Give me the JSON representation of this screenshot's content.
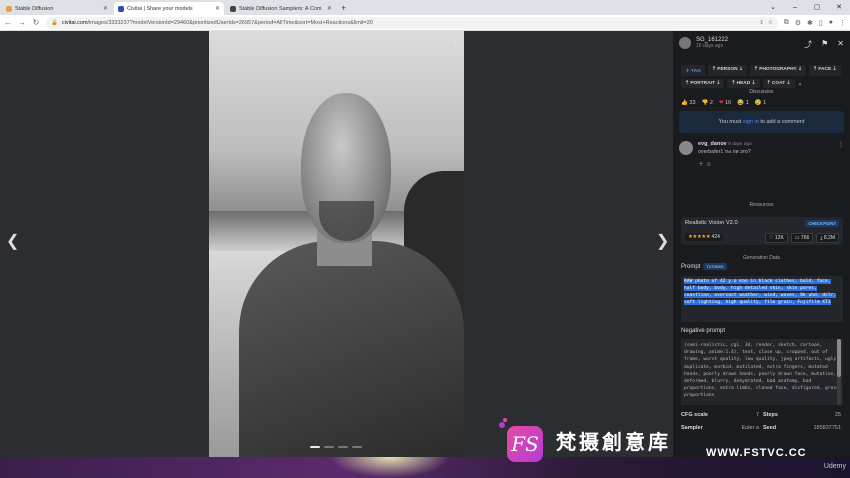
{
  "browser": {
    "tabs": [
      {
        "title": "Stable Diffusion",
        "color": "#e8a23a"
      },
      {
        "title": "Civitai | Share your models",
        "color": "#2d4fb5"
      },
      {
        "title": "Stable Diffusion Samplers: A Com",
        "color": "#444444"
      }
    ],
    "new_tab": "+",
    "url_host": "civitai.com",
    "url_path": "/images/3333237?modelVersionId=29460&prioritizedUserIds=26957&period=AllTime&sort=Most+Reactions&limit=20"
  },
  "panel": {
    "username": "SG_161222",
    "user_time": "16 days ago",
    "tags": [
      "TAG",
      "PERSON",
      "PHOTOGRAPHY",
      "FACE",
      "PORTRAIT",
      "HEAD",
      "COAT"
    ],
    "discussion_heading": "Discussion",
    "reactions": [
      {
        "icon": "👍",
        "count": "33"
      },
      {
        "icon": "👎",
        "count": "2"
      },
      {
        "icon": "❤",
        "count": "16"
      },
      {
        "icon": "😂",
        "count": "1"
      },
      {
        "icon": "😢",
        "count": "1"
      }
    ],
    "signin_prefix": "You must",
    "signin_link": "sign in",
    "signin_suffix": "to add a comment",
    "comment": {
      "author": "evg_danov",
      "time": "9 days ago",
      "text": "overbafer1 ты ли это?"
    },
    "resources_heading": "Resources",
    "resource": {
      "name": "Realistic Vision V2.0",
      "badge": "CHECKPOINT",
      "rating_count": "424",
      "likes": "12K",
      "comments": "766",
      "downloads": "8.2M"
    },
    "generation_heading": "Generation Data",
    "prompt_label": "Prompt",
    "prompt_badge": "TXT2IMG",
    "prompt_text": "RAW photo of 42 y.o man in black clothes, bald, face, half body, body, high detailed skin, skin pores, coastline, overcast weather, wind, waves, 8k uhd, dslr, soft lighting, high quality, film grain, Fujifilm XT3",
    "negative_label": "Negative prompt",
    "negative_text": "(semi-realistic, cgi, 3d, render, sketch, cartoon, drawing, anime:1.4), text, close up, cropped, out of frame, worst quality, low quality, jpeg artifacts, ugly, duplicate, morbid, mutilated, extra fingers, mutated hands, poorly drawn hands, poorly drawn face, mutation, deformed, blurry, dehydrated, bad anatomy, bad proportions, extra limbs, cloned face, disfigured, gross proportions",
    "params": [
      {
        "k1": "CFG scale",
        "v1": "7",
        "k2": "Steps",
        "v2": "25"
      },
      {
        "k1": "Sampler",
        "v1": "Euler a",
        "k2": "Seed",
        "v2": "185837751"
      }
    ]
  },
  "watermark": {
    "cn": "梵摄創意库",
    "url": "WWW.FSTVC.CC",
    "logo": "FS"
  },
  "footer": {
    "brand": "Udemy"
  }
}
